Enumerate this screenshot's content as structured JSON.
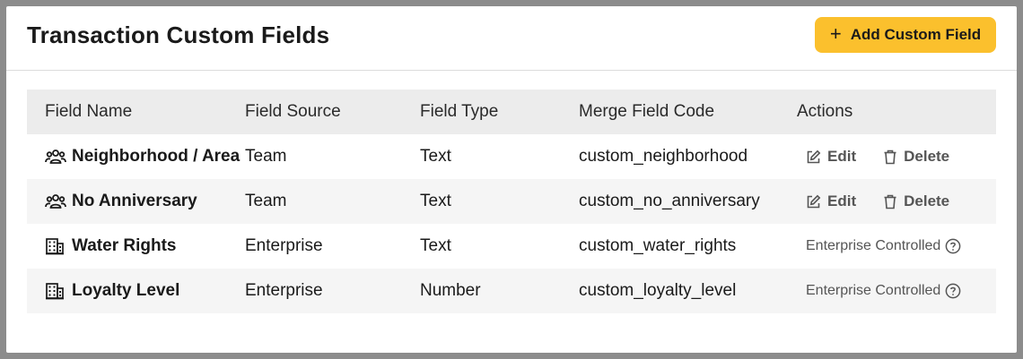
{
  "header": {
    "title": "Transaction Custom Fields",
    "add_button_icon": "plus-icon",
    "add_button_label": "Add Custom Field",
    "add_button_color": "#fbc02d"
  },
  "table": {
    "columns": [
      "Field Name",
      "Field Source",
      "Field Type",
      "Merge Field Code",
      "Actions"
    ],
    "rows": [
      {
        "icon": "team-icon",
        "name": "Neighborhood / Area",
        "source": "Team",
        "type": "Text",
        "code": "custom_neighborhood",
        "edit_label": "Edit",
        "delete_label": "Delete"
      },
      {
        "icon": "team-icon",
        "name": "No Anniversary",
        "source": "Team",
        "type": "Text",
        "code": "custom_no_anniversary",
        "edit_label": "Edit",
        "delete_label": "Delete"
      },
      {
        "icon": "building-icon",
        "name": "Water Rights",
        "source": "Enterprise",
        "type": "Text",
        "code": "custom_water_rights",
        "note": "Enterprise Controlled"
      },
      {
        "icon": "building-icon",
        "name": "Loyalty Level",
        "source": "Enterprise",
        "type": "Number",
        "code": "custom_loyalty_level",
        "note": "Enterprise Controlled"
      }
    ]
  }
}
